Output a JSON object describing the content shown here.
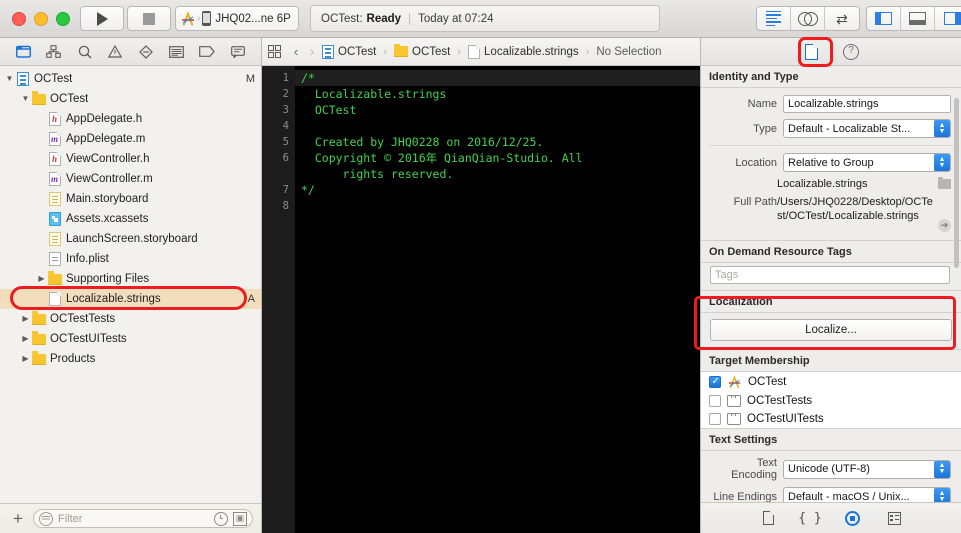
{
  "titlebar": {
    "run_label": "Run",
    "stop_label": "Stop",
    "scheme": "JHQ02...ne 6P",
    "status_project": "OCTest:",
    "status_state": "Ready",
    "status_time": "Today at 07:24",
    "editor_segments": [
      "standard-editor-icon",
      "assistant-editor-icon",
      "version-editor-icon"
    ],
    "view_segments": [
      "navigator-panel-icon",
      "debug-panel-icon",
      "utilities-panel-icon"
    ]
  },
  "navigator": {
    "tabs": [
      "project-navigator-icon",
      "symbol-navigator-icon",
      "find-navigator-icon",
      "issue-navigator-icon",
      "test-navigator-icon",
      "debug-navigator-icon",
      "breakpoint-navigator-icon",
      "report-navigator-icon"
    ],
    "tree": [
      {
        "label": "OCTest",
        "indent": 0,
        "icon": "project",
        "twisty": "open",
        "badge": "M"
      },
      {
        "label": "OCTest",
        "indent": 1,
        "icon": "folder",
        "twisty": "open",
        "badge": ""
      },
      {
        "label": "AppDelegate.h",
        "indent": 2,
        "icon": "h",
        "twisty": "none",
        "badge": ""
      },
      {
        "label": "AppDelegate.m",
        "indent": 2,
        "icon": "m",
        "twisty": "none",
        "badge": ""
      },
      {
        "label": "ViewController.h",
        "indent": 2,
        "icon": "h",
        "twisty": "none",
        "badge": ""
      },
      {
        "label": "ViewController.m",
        "indent": 2,
        "icon": "m",
        "twisty": "none",
        "badge": ""
      },
      {
        "label": "Main.storyboard",
        "indent": 2,
        "icon": "storyboard",
        "twisty": "none",
        "badge": ""
      },
      {
        "label": "Assets.xcassets",
        "indent": 2,
        "icon": "xcassets",
        "twisty": "none",
        "badge": ""
      },
      {
        "label": "LaunchScreen.storyboard",
        "indent": 2,
        "icon": "storyboard",
        "twisty": "none",
        "badge": ""
      },
      {
        "label": "Info.plist",
        "indent": 2,
        "icon": "plist",
        "twisty": "none",
        "badge": ""
      },
      {
        "label": "Supporting Files",
        "indent": 2,
        "icon": "folder",
        "twisty": "closed",
        "badge": ""
      },
      {
        "label": "Localizable.strings",
        "indent": 2,
        "icon": "blank",
        "twisty": "none",
        "badge": "A",
        "selected": true
      },
      {
        "label": "OCTestTests",
        "indent": 1,
        "icon": "folder",
        "twisty": "closed",
        "badge": ""
      },
      {
        "label": "OCTestUITests",
        "indent": 1,
        "icon": "folder",
        "twisty": "closed",
        "badge": ""
      },
      {
        "label": "Products",
        "indent": 1,
        "icon": "folder",
        "twisty": "closed",
        "badge": ""
      }
    ],
    "add_button": "+",
    "filter_placeholder": "Filter"
  },
  "editor": {
    "breadcrumbs": [
      {
        "label": "OCTest",
        "icon": "project"
      },
      {
        "label": "OCTest",
        "icon": "folder"
      },
      {
        "label": "Localizable.strings",
        "icon": "blank"
      },
      {
        "label": "No Selection",
        "icon": "none"
      }
    ],
    "line_numbers": [
      "1",
      "2",
      "3",
      "4",
      "5",
      "6",
      "",
      "7",
      "8"
    ],
    "code_lines": [
      "/*",
      "  Localizable.strings",
      "  OCTest",
      "",
      "  Created by JHQ0228 on 2016/12/25.",
      "  Copyright © 2016年 QianQian-Studio. All",
      "      rights reserved.",
      "*/",
      ""
    ]
  },
  "inspector": {
    "tabs": [
      "file-inspector-icon",
      "quick-help-icon"
    ],
    "identity_section": {
      "title": "Identity and Type",
      "name_label": "Name",
      "name_value": "Localizable.strings",
      "type_label": "Type",
      "type_value": "Default - Localizable St...",
      "location_label": "Location",
      "location_value": "Relative to Group",
      "location_file": "Localizable.strings",
      "full_path_label": "Full Path",
      "full_path_value": "/Users/JHQ0228/Desktop/OCTest/OCTest/Localizable.strings"
    },
    "odr_section": {
      "title": "On Demand Resource Tags",
      "tags_placeholder": "Tags"
    },
    "localization_section": {
      "title": "Localization",
      "localize_button": "Localize..."
    },
    "target_membership": {
      "title": "Target Membership",
      "rows": [
        {
          "label": "OCTest",
          "checked": true,
          "icon": "app"
        },
        {
          "label": "OCTestTests",
          "checked": false,
          "icon": "test"
        },
        {
          "label": "OCTestUITests",
          "checked": false,
          "icon": "test"
        }
      ]
    },
    "text_settings": {
      "title": "Text Settings",
      "encoding_label": "Text Encoding",
      "encoding_value": "Unicode (UTF-8)",
      "endings_label": "Line Endings",
      "endings_value": "Default - macOS / Unix..."
    },
    "library_tabs": [
      "file-template-library-icon",
      "code-snippet-library-icon",
      "object-library-icon",
      "media-library-icon"
    ]
  },
  "colors": {
    "accent_blue": "#1a74d8",
    "annotation_red": "#ee1b20",
    "selection_tan": "#f2ddbd",
    "code_green": "#3fd44f",
    "folder_yellow": "#f7c52d"
  }
}
